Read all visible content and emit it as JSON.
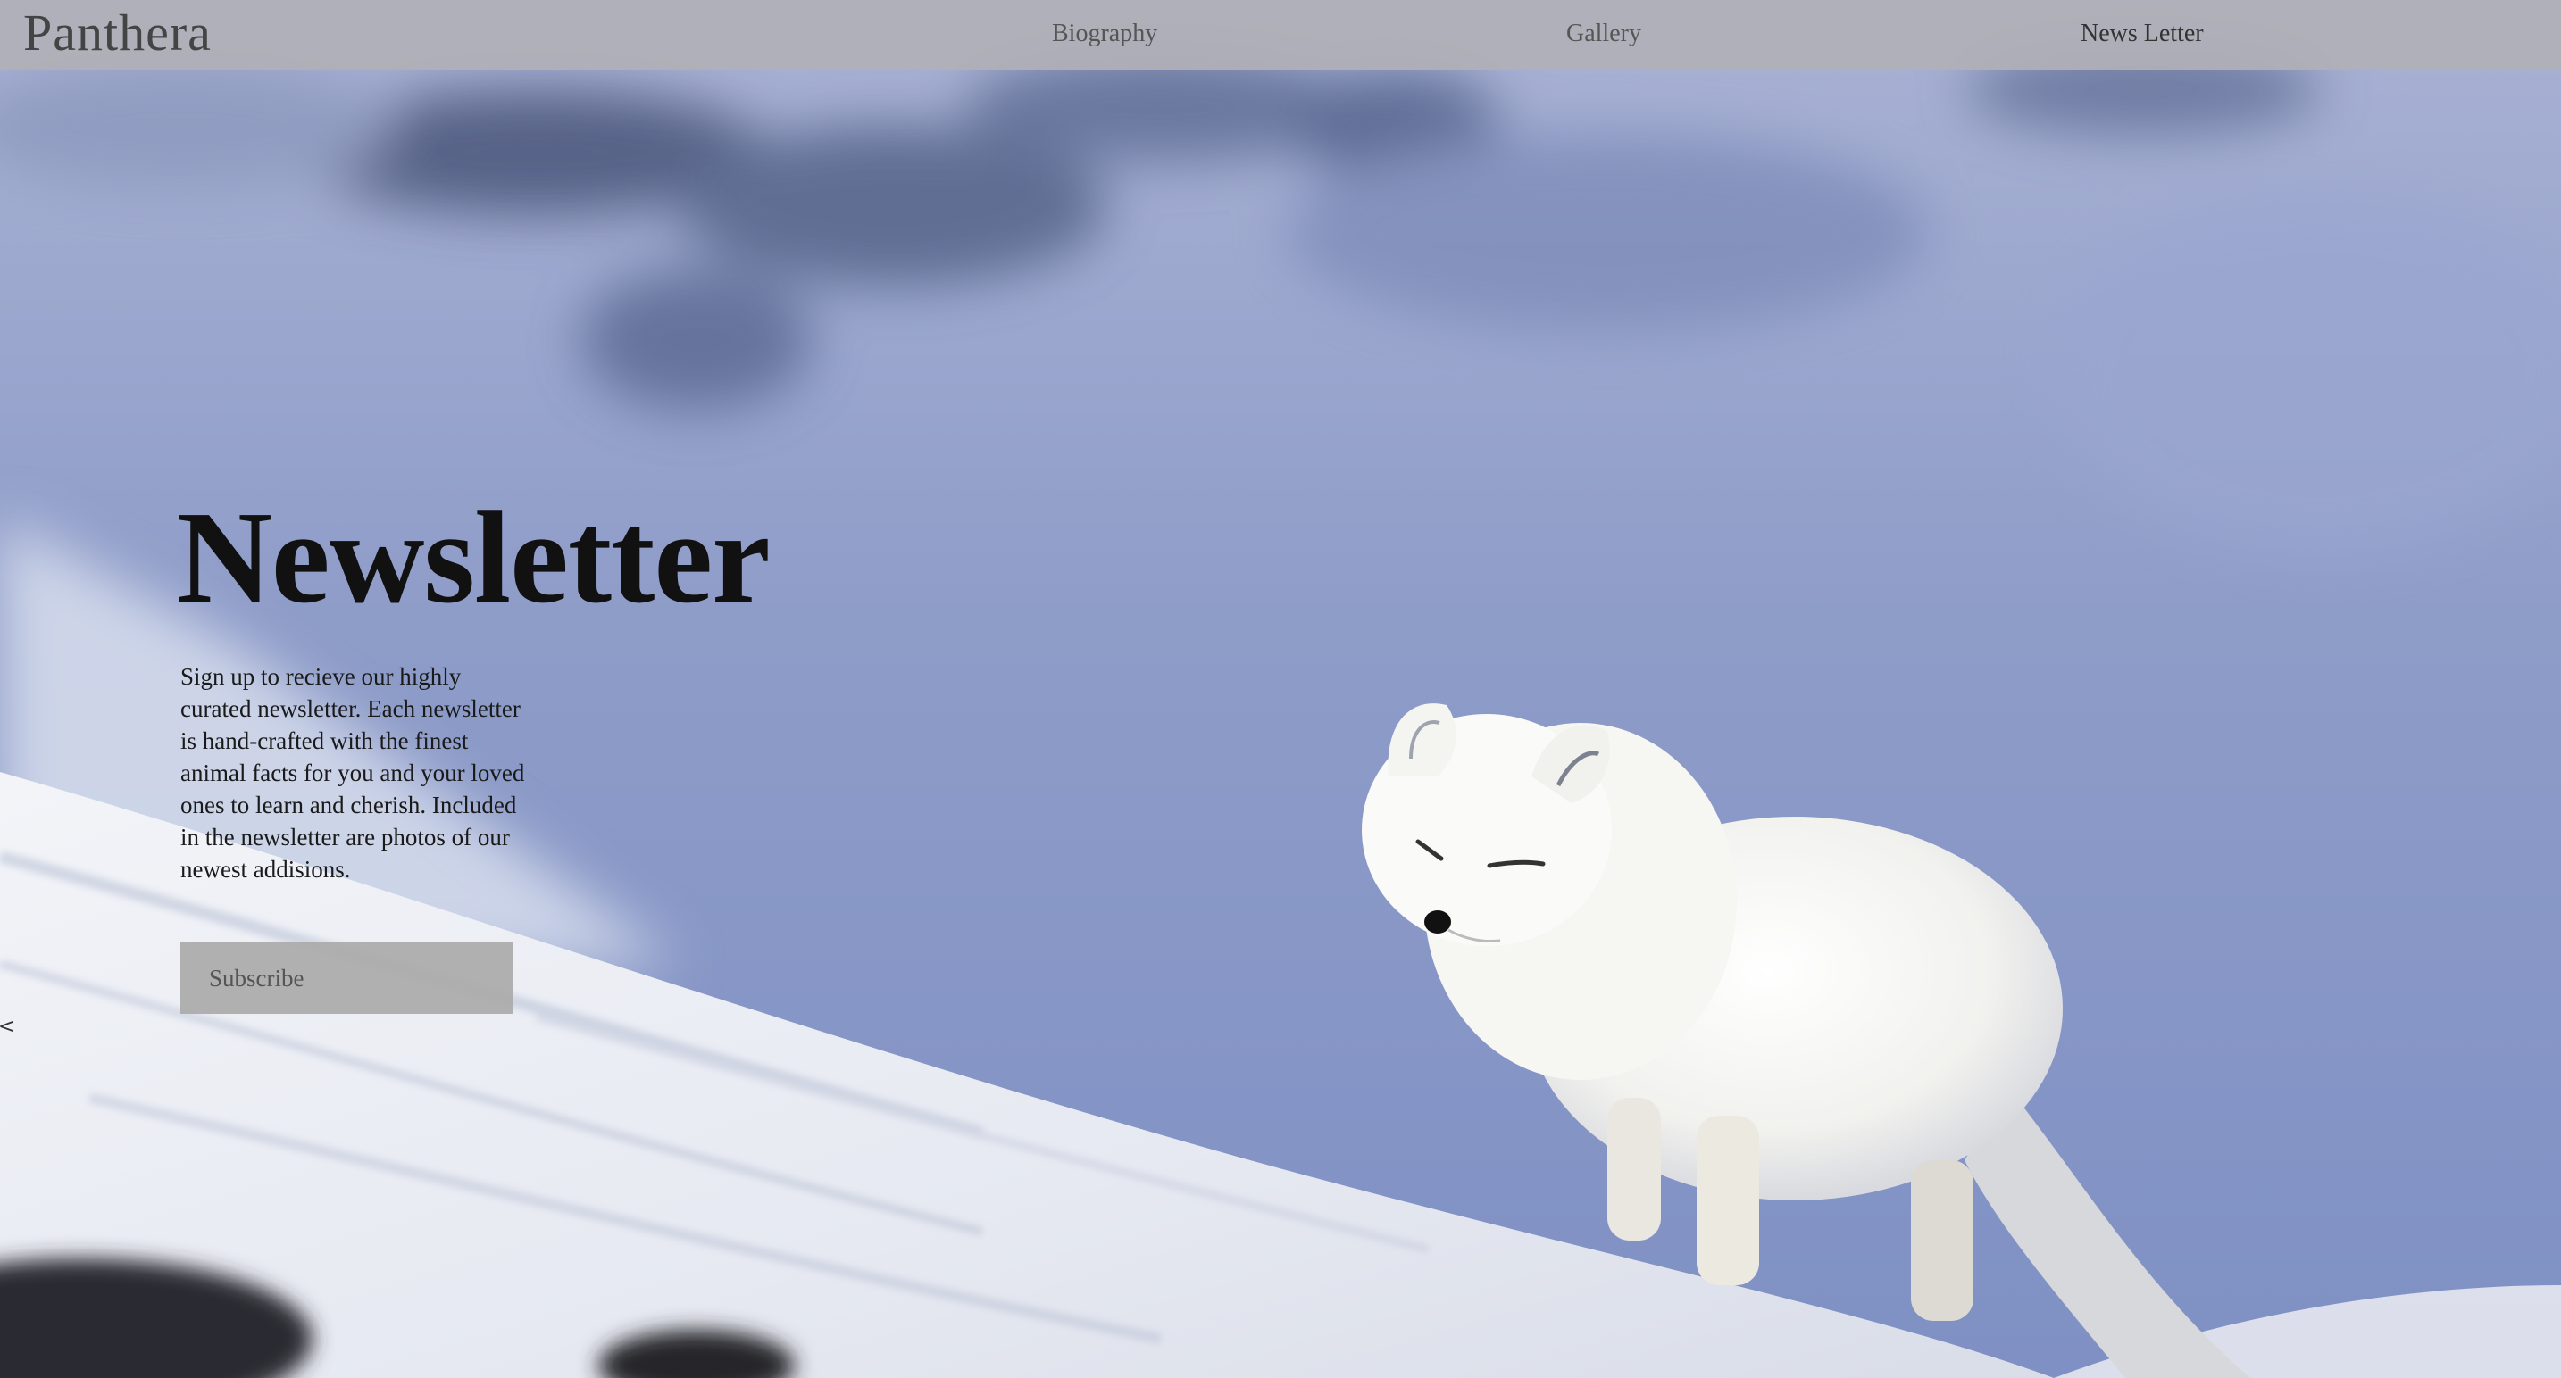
{
  "brand": "Panthera",
  "nav": {
    "biography": "Biography",
    "gallery": "Gallery",
    "newsletter": "News Letter"
  },
  "hero": {
    "title": "Newsletter",
    "description": "Sign up to recieve our highly curated newsletter. Each newsletter is hand-crafted with the finest animal facts for you and your loved ones to learn and cherish. Included in the newsletter are photos of our newest addisions.",
    "subscribe_label": "Subscribe"
  },
  "edge_glyph": "<",
  "colors": {
    "sky": "#8f9dc4",
    "snow": "#eef0f5",
    "navbar": "#b0b0b6",
    "button": "#aaaaaa"
  }
}
